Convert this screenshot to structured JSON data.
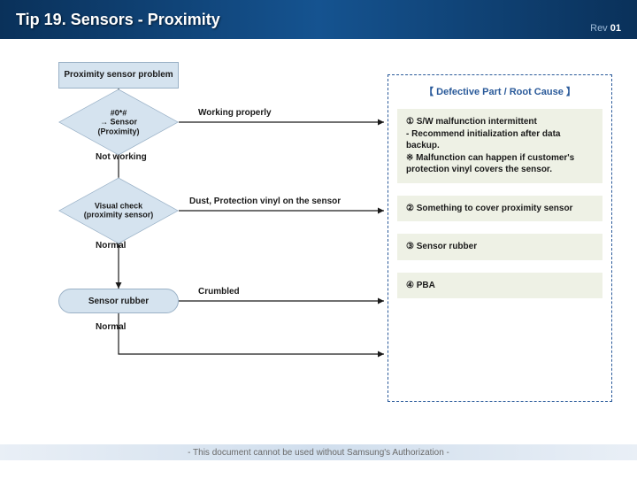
{
  "header": {
    "title": "Tip 19. Sensors - Proximity",
    "rev_label": "Rev ",
    "rev_num": "01"
  },
  "flow": {
    "start": "Proximity sensor problem",
    "d1": {
      "line1": "#0*#",
      "line2": "→ Sensor",
      "line3": "(Proximity)"
    },
    "d1_right": "Working properly",
    "d1_down": "Not working",
    "d2": {
      "line1": "Visual check",
      "line2": "(proximity sensor)"
    },
    "d2_right": "Dust, Protection vinyl on the sensor",
    "d2_down": "Normal",
    "r1": "Sensor rubber",
    "r1_right": "Crumbled",
    "r1_down": "Normal"
  },
  "panel": {
    "title": "【 Defective Part / Root Cause 】",
    "c1": "① S/W malfunction intermittent\n- Recommend initialization after data backup.\n※ Malfunction can happen if customer's protection vinyl covers the sensor.",
    "c2": "② Something to cover proximity sensor",
    "c3": "③ Sensor rubber",
    "c4": "④ PBA"
  },
  "footer": "- This document cannot be used without Samsung's Authorization -"
}
